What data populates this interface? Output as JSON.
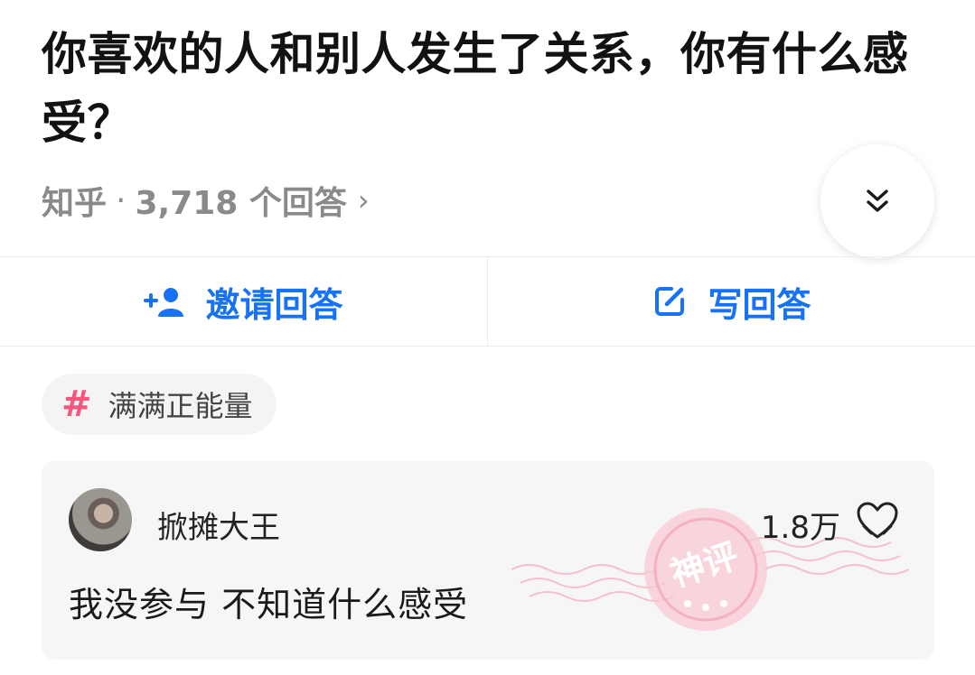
{
  "question": {
    "title": "你喜欢的人和别人发生了关系，你有什么感受？",
    "source": "知乎",
    "separator": "·",
    "answer_count": "3,718 个回答",
    "more_chevron": "›"
  },
  "actions": {
    "invite_label": "邀请回答",
    "write_label": "写回答"
  },
  "topic": {
    "hash": "#",
    "label": "满满正能量"
  },
  "answer": {
    "author": "掀摊大王",
    "likes": "1.8万",
    "text": "我没参与  不知道什么感受",
    "stamp_text": "神评"
  },
  "colors": {
    "accent": "#1772f6",
    "hash": "#f4577b",
    "stamp": "#f4a8b8"
  },
  "icons": {
    "expand": "double-chevron-down-icon",
    "invite": "add-person-icon",
    "write": "edit-icon",
    "like": "heart-hands-icon"
  }
}
